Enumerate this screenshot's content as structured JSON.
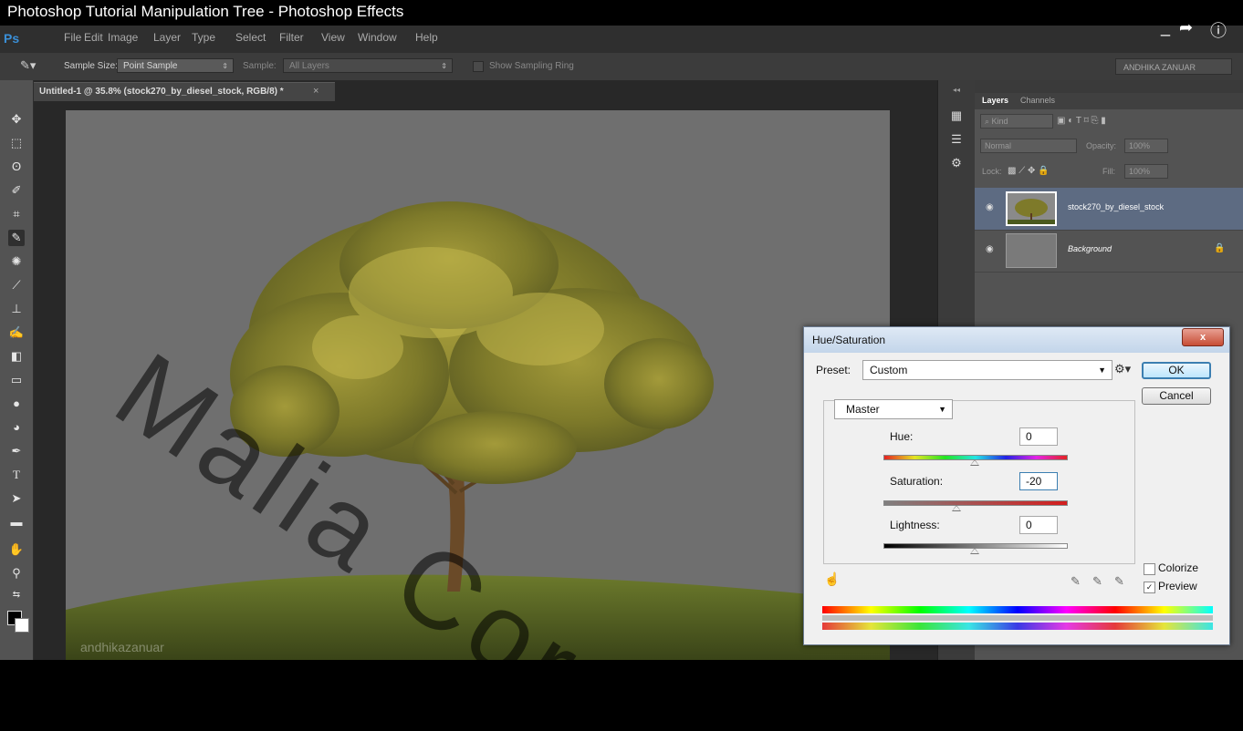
{
  "video": {
    "title": "Photoshop Tutorial Manipulation Tree - Photoshop Effects",
    "watermark": "Malia Cor",
    "instagram_handle": "andhikazanuar"
  },
  "app": {
    "logo": "Ps",
    "menu": [
      "File",
      "Edit",
      "Image",
      "Layer",
      "Type",
      "Select",
      "Filter",
      "View",
      "Window",
      "Help"
    ],
    "user": "ANDHIKA ZANUAR"
  },
  "options": {
    "sample_size_label": "Sample Size:",
    "sample_size_value": "Point Sample",
    "sample_label": "Sample:",
    "sample_value": "All Layers",
    "show_ring_label": "Show Sampling Ring"
  },
  "document": {
    "tab_title": "Untitled-1 @ 35.8% (stock270_by_diesel_stock, RGB/8) *",
    "close_glyph": "×"
  },
  "layers_panel": {
    "tabs": [
      "Layers",
      "Channels"
    ],
    "filter_kind": "Kind",
    "blend_mode": "Normal",
    "opacity_label": "Opacity:",
    "opacity_value": "100%",
    "lock_label": "Lock:",
    "fill_label": "Fill:",
    "fill_value": "100%",
    "layers": [
      {
        "name": "stock270_by_diesel_stock",
        "selected": true
      },
      {
        "name": "Background",
        "selected": false,
        "locked": true
      }
    ]
  },
  "dialog": {
    "title": "Hue/Saturation",
    "close_glyph": "x",
    "preset_label": "Preset:",
    "preset_value": "Custom",
    "ok_label": "OK",
    "cancel_label": "Cancel",
    "channel": "Master",
    "hue_label": "Hue:",
    "hue_value": "0",
    "saturation_label": "Saturation:",
    "saturation_value": "-20",
    "lightness_label": "Lightness:",
    "lightness_value": "0",
    "colorize_label": "Colorize",
    "colorize_checked": false,
    "preview_label": "Preview",
    "preview_checked": true,
    "hue_level": 0.5,
    "saturation_level": 0.4,
    "lightness_level": 0.5
  },
  "colors": {
    "accent": "#3c7fb1",
    "canvas_bg": "#6f6f6f",
    "selected_layer": "#5d6b82"
  }
}
